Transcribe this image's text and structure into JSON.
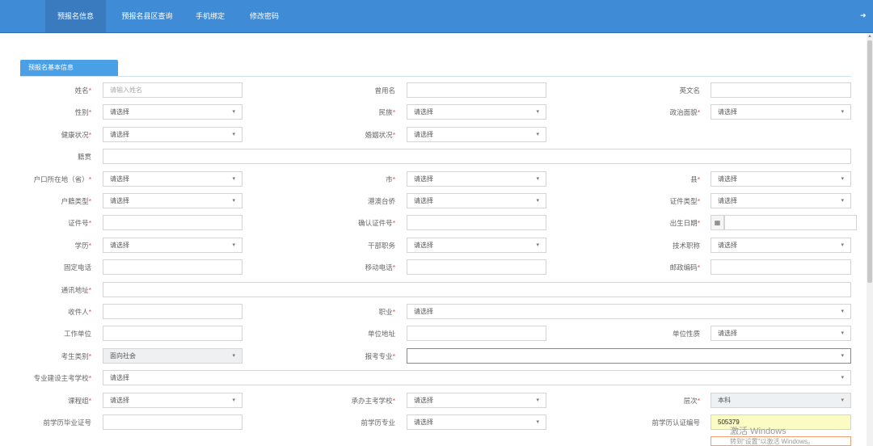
{
  "nav": {
    "tabs": [
      "预报名信息",
      "预报名县区查询",
      "手机绑定",
      "修改密码"
    ],
    "active": 0
  },
  "section_title": "预报名基本信息",
  "select_default": "请选择",
  "rows": [
    [
      {
        "label": "姓名",
        "req": true,
        "type": "input",
        "placeholder": "请输入姓名"
      },
      {
        "label": "曾用名",
        "req": false,
        "type": "input"
      },
      {
        "label": "英文名",
        "req": false,
        "type": "input"
      }
    ],
    [
      {
        "label": "性别",
        "req": true,
        "type": "select"
      },
      {
        "label": "民族",
        "req": true,
        "type": "select"
      },
      {
        "label": "政治面貌",
        "req": true,
        "type": "select"
      }
    ],
    [
      {
        "label": "健康状况",
        "req": true,
        "type": "select"
      },
      {
        "label": "婚姻状况",
        "req": true,
        "type": "select"
      }
    ],
    [
      {
        "label": "籍贯",
        "req": false,
        "type": "input",
        "full": true
      }
    ],
    [
      {
        "label": "户口所在地（省）",
        "req": true,
        "type": "select"
      },
      {
        "label": "市",
        "req": true,
        "type": "select"
      },
      {
        "label": "县",
        "req": true,
        "type": "select"
      }
    ],
    [
      {
        "label": "户籍类型",
        "req": true,
        "type": "select"
      },
      {
        "label": "港澳台侨",
        "req": false,
        "type": "select"
      },
      {
        "label": "证件类型",
        "req": true,
        "type": "select"
      }
    ],
    [
      {
        "label": "证件号",
        "req": true,
        "type": "input"
      },
      {
        "label": "确认证件号",
        "req": true,
        "type": "input"
      },
      {
        "label": "出生日期",
        "req": true,
        "type": "date"
      }
    ],
    [
      {
        "label": "学历",
        "req": true,
        "type": "select"
      },
      {
        "label": "干部职务",
        "req": false,
        "type": "select"
      },
      {
        "label": "技术职称",
        "req": false,
        "type": "select"
      }
    ],
    [
      {
        "label": "固定电话",
        "req": false,
        "type": "input"
      },
      {
        "label": "移动电话",
        "req": true,
        "type": "input"
      },
      {
        "label": "邮政编码",
        "req": true,
        "type": "input"
      }
    ],
    [
      {
        "label": "通讯地址",
        "req": true,
        "type": "input",
        "full": true
      }
    ],
    [
      {
        "label": "收件人",
        "req": true,
        "type": "input"
      },
      {
        "label": "职业",
        "req": true,
        "type": "select",
        "wide": true
      }
    ],
    [
      {
        "label": "工作单位",
        "req": false,
        "type": "input"
      },
      {
        "label": "单位地址",
        "req": false,
        "type": "input"
      },
      {
        "label": "单位性质",
        "req": false,
        "type": "select"
      }
    ],
    [
      {
        "label": "考生类别",
        "req": true,
        "type": "select",
        "value": "面向社会",
        "disabled": true
      },
      {
        "label": "报考专业",
        "req": true,
        "type": "select",
        "wide": true,
        "value": "",
        "focus": true
      }
    ],
    [
      {
        "label": "专业建设主考学校",
        "req": true,
        "type": "select",
        "full": true
      }
    ],
    [
      {
        "label": "课程组",
        "req": true,
        "type": "select"
      },
      {
        "label": "承办主考学校",
        "req": true,
        "type": "select"
      },
      {
        "label": "层次",
        "req": true,
        "type": "select",
        "value": "本科",
        "disabled": true
      }
    ],
    [
      {
        "label": "前学历毕业证号",
        "req": false,
        "type": "input"
      },
      {
        "label": "前学历专业",
        "req": false,
        "type": "select"
      },
      {
        "label": "前学历认证编号",
        "req": false,
        "type": "input",
        "value": "505379",
        "yellow": true
      }
    ]
  ],
  "icons": {
    "calendar": "calendar-icon",
    "logout": "logout-icon"
  },
  "watermark": {
    "line1": "激活 Windows",
    "line2": "转到“设置”以激活 Windows。"
  }
}
